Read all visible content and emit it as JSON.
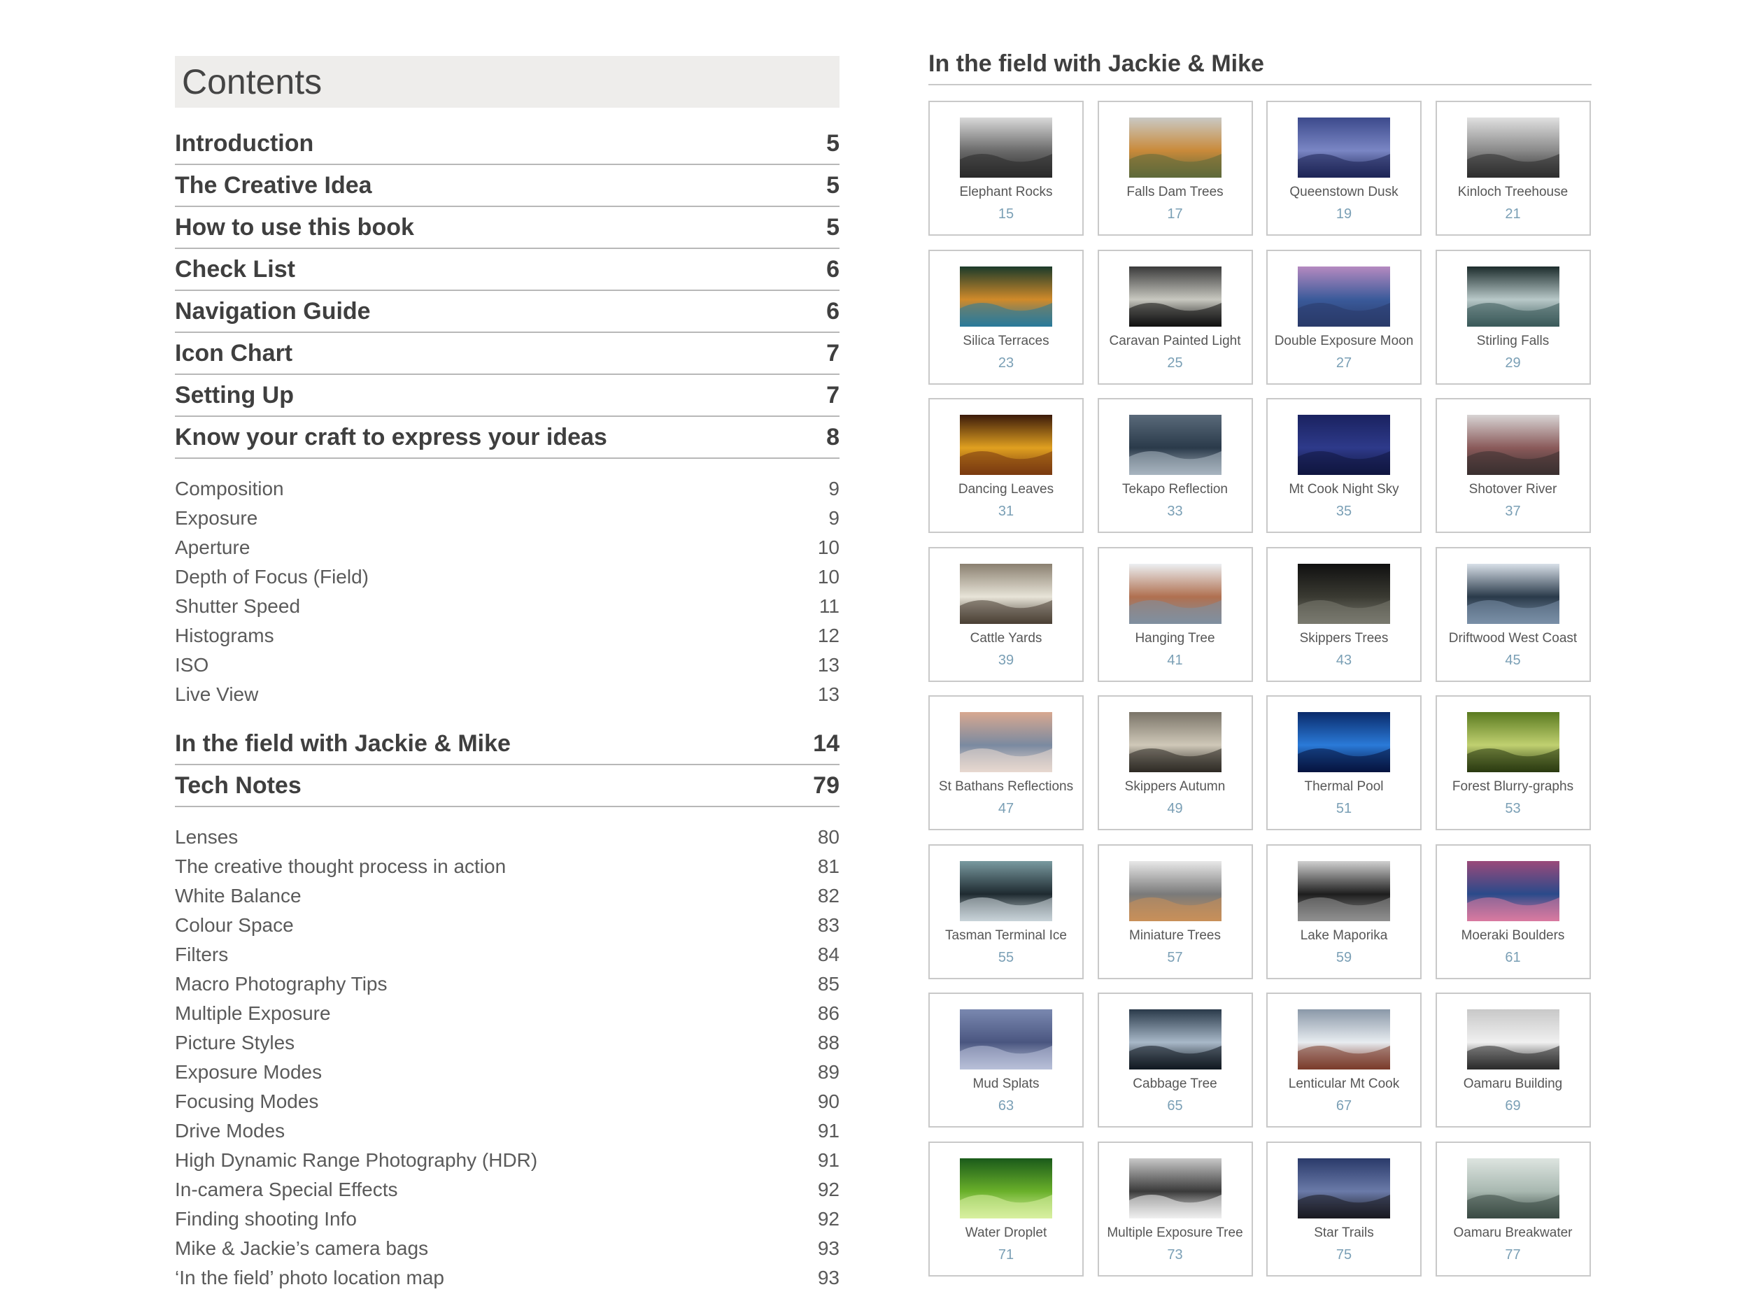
{
  "contents": {
    "title": "Contents",
    "major_a": [
      {
        "label": "Introduction",
        "page": "5"
      },
      {
        "label": "The Creative Idea",
        "page": "5"
      },
      {
        "label": "How to use this book",
        "page": "5"
      },
      {
        "label": "Check List",
        "page": "6"
      },
      {
        "label": "Navigation Guide",
        "page": "6"
      },
      {
        "label": "Icon Chart",
        "page": "7"
      },
      {
        "label": "Setting Up",
        "page": "7"
      },
      {
        "label": "Know your craft to express your ideas",
        "page": "8"
      }
    ],
    "minor_a": [
      {
        "label": "Composition",
        "page": "9"
      },
      {
        "label": "Exposure",
        "page": "9"
      },
      {
        "label": "Aperture",
        "page": "10"
      },
      {
        "label": "Depth of Focus (Field)",
        "page": "10"
      },
      {
        "label": "Shutter Speed",
        "page": "11"
      },
      {
        "label": "Histograms",
        "page": "12"
      },
      {
        "label": "ISO",
        "page": "13"
      },
      {
        "label": "Live View",
        "page": "13"
      }
    ],
    "major_b": [
      {
        "label": "In the field with Jackie & Mike",
        "page": "14"
      },
      {
        "label": "Tech Notes",
        "page": "79"
      }
    ],
    "minor_b": [
      {
        "label": "Lenses",
        "page": "80"
      },
      {
        "label": "The creative thought process in action",
        "page": "81"
      },
      {
        "label": "White Balance",
        "page": "82"
      },
      {
        "label": "Colour Space",
        "page": "83"
      },
      {
        "label": "Filters",
        "page": "84"
      },
      {
        "label": "Macro Photography Tips",
        "page": "85"
      },
      {
        "label": "Multiple Exposure",
        "page": "86"
      },
      {
        "label": "Picture Styles",
        "page": "88"
      },
      {
        "label": "Exposure Modes",
        "page": "89"
      },
      {
        "label": "Focusing Modes",
        "page": "90"
      },
      {
        "label": "Drive Modes",
        "page": "91"
      },
      {
        "label": "High Dynamic Range Photography (HDR)",
        "page": "91"
      },
      {
        "label": "In-camera Special Effects",
        "page": "92"
      },
      {
        "label": "Finding shooting Info",
        "page": "92"
      },
      {
        "label": "Mike & Jackie’s camera bags",
        "page": "93"
      },
      {
        "label": "‘In the field’ photo location map",
        "page": "93"
      }
    ]
  },
  "gallery": {
    "title": "In the field with Jackie & Mike",
    "items": [
      {
        "caption": "Elephant Rocks",
        "page": "15",
        "colors": [
          "#d9d9d9",
          "#6b6b6b",
          "#2a2a2a"
        ]
      },
      {
        "caption": "Falls Dam Trees",
        "page": "17",
        "colors": [
          "#c9c9c4",
          "#c98a3a",
          "#5e6a3a"
        ]
      },
      {
        "caption": "Queenstown Dusk",
        "page": "19",
        "colors": [
          "#3c4a8c",
          "#7a86c4",
          "#1d2456"
        ]
      },
      {
        "caption": "Kinloch Treehouse",
        "page": "21",
        "colors": [
          "#e0e0e0",
          "#8a8a8a",
          "#2e2e2e"
        ]
      },
      {
        "caption": "Silica Terraces",
        "page": "23",
        "colors": [
          "#1a3a2a",
          "#d08a2a",
          "#2a7a9a"
        ]
      },
      {
        "caption": "Caravan Painted Light",
        "page": "25",
        "colors": [
          "#3a3a3a",
          "#c8c8c0",
          "#101010"
        ]
      },
      {
        "caption": "Double Exposure Moon",
        "page": "27",
        "colors": [
          "#b58ac0",
          "#3a5a9a",
          "#2a3a6a"
        ]
      },
      {
        "caption": "Stirling Falls",
        "page": "29",
        "colors": [
          "#1c2c2c",
          "#b8c8c8",
          "#3a5a5a"
        ]
      },
      {
        "caption": "Dancing Leaves",
        "page": "31",
        "colors": [
          "#3a1a0a",
          "#e0a020",
          "#7a3a10"
        ]
      },
      {
        "caption": "Tekapo Reflection",
        "page": "33",
        "colors": [
          "#5a6a7a",
          "#2a3a4a",
          "#a8b4c0"
        ]
      },
      {
        "caption": "Mt Cook Night Sky",
        "page": "35",
        "colors": [
          "#1a2260",
          "#2e3a8a",
          "#101640"
        ]
      },
      {
        "caption": "Shotover River",
        "page": "37",
        "colors": [
          "#d8d4d4",
          "#8a5a5a",
          "#3a3030"
        ]
      },
      {
        "caption": "Cattle Yards",
        "page": "39",
        "colors": [
          "#8a8070",
          "#e8e4d8",
          "#4a4034"
        ]
      },
      {
        "caption": "Hanging Tree",
        "page": "41",
        "colors": [
          "#eceff2",
          "#b07050",
          "#8090a0"
        ]
      },
      {
        "caption": "Skippers Trees",
        "page": "43",
        "colors": [
          "#101010",
          "#3a3a32",
          "#7a7a70"
        ]
      },
      {
        "caption": "Driftwood West Coast",
        "page": "45",
        "colors": [
          "#d8e0e8",
          "#2a3a4a",
          "#7a90a8"
        ]
      },
      {
        "caption": "St Bathans Reflections",
        "page": "47",
        "colors": [
          "#d8a890",
          "#7a8aa0",
          "#e8d8d0"
        ]
      },
      {
        "caption": "Skippers Autumn",
        "page": "49",
        "colors": [
          "#7a7468",
          "#cfc8b8",
          "#2e2a24"
        ]
      },
      {
        "caption": "Thermal Pool",
        "page": "51",
        "colors": [
          "#0a2a6a",
          "#2a7ad8",
          "#061440"
        ]
      },
      {
        "caption": "Forest Blurry-graphs",
        "page": "53",
        "colors": [
          "#5a7a20",
          "#c0d070",
          "#2a3a10"
        ]
      },
      {
        "caption": "Tasman Terminal Ice",
        "page": "55",
        "colors": [
          "#7a9aa0",
          "#1e2a30",
          "#c8d4d8"
        ]
      },
      {
        "caption": "Miniature Trees",
        "page": "57",
        "colors": [
          "#e8e8e8",
          "#7a7a7a",
          "#c8905a"
        ]
      },
      {
        "caption": "Lake Maporika",
        "page": "59",
        "colors": [
          "#d0d0d0",
          "#1e1e1e",
          "#909090"
        ]
      },
      {
        "caption": "Moeraki Boulders",
        "page": "61",
        "colors": [
          "#9a4a7a",
          "#2a4a8a",
          "#d87aa0"
        ]
      },
      {
        "caption": "Mud Splats",
        "page": "63",
        "colors": [
          "#7a88b0",
          "#4a5680",
          "#b8c0d8"
        ]
      },
      {
        "caption": "Cabbage Tree",
        "page": "65",
        "colors": [
          "#2a3a4a",
          "#a8b8c8",
          "#101820"
        ]
      },
      {
        "caption": "Lenticular Mt Cook",
        "page": "67",
        "colors": [
          "#8a98a8",
          "#e8ecf0",
          "#7a3a2a"
        ]
      },
      {
        "caption": "Oamaru Building",
        "page": "69",
        "colors": [
          "#c8c8c8",
          "#f0f0f0",
          "#2a2a2a"
        ]
      },
      {
        "caption": "Water Droplet",
        "page": "71",
        "colors": [
          "#1a5a1a",
          "#6ab02a",
          "#d8f0a0"
        ]
      },
      {
        "caption": "Multiple Exposure Tree",
        "page": "73",
        "colors": [
          "#c8c8c8",
          "#3a3a3a",
          "#f0f0f0"
        ]
      },
      {
        "caption": "Star Trails",
        "page": "75",
        "colors": [
          "#2a3a6a",
          "#6a7aa8",
          "#1a1a20"
        ]
      },
      {
        "caption": "Oamaru Breakwater",
        "page": "77",
        "colors": [
          "#dde4e0",
          "#a8b8b0",
          "#3a4a44"
        ]
      }
    ]
  }
}
